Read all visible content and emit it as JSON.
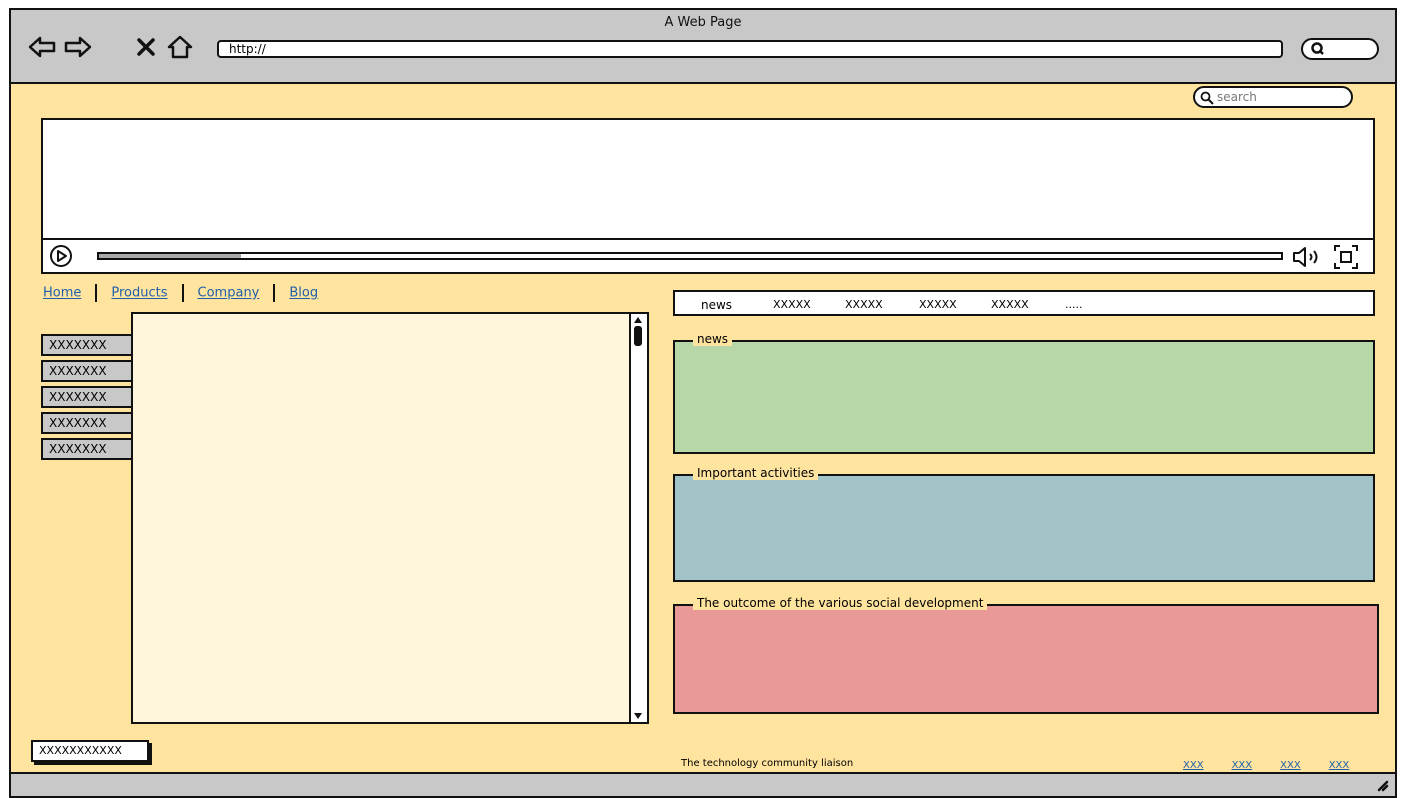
{
  "window": {
    "title": "A Web Page",
    "url": "http://"
  },
  "search": {
    "placeholder": "search"
  },
  "video": {
    "progress": 0.12
  },
  "nav": {
    "items": [
      "Home",
      "Products",
      "Company",
      "Blog"
    ]
  },
  "sidebar": {
    "items": [
      "XXXXXXX",
      "XXXXXXX",
      "XXXXXXX",
      "XXXXXXX",
      "XXXXXXX"
    ]
  },
  "tabs": {
    "items": [
      "news",
      "XXXXX",
      "XXXXX",
      "XXXXX",
      "XXXXX",
      "....."
    ]
  },
  "panels": {
    "news": {
      "title": "news",
      "color": "#b7d7a8"
    },
    "activities": {
      "title": "Important activities",
      "color": "#a2c4c9"
    },
    "outcome": {
      "title": "The outcome of the various social development",
      "color": "#ea9999"
    }
  },
  "footer": {
    "button": "XXXXXXXXXXX",
    "text": "The technology community liaison",
    "links": [
      "XXX",
      "XXX",
      "XXX",
      "XXX"
    ]
  }
}
